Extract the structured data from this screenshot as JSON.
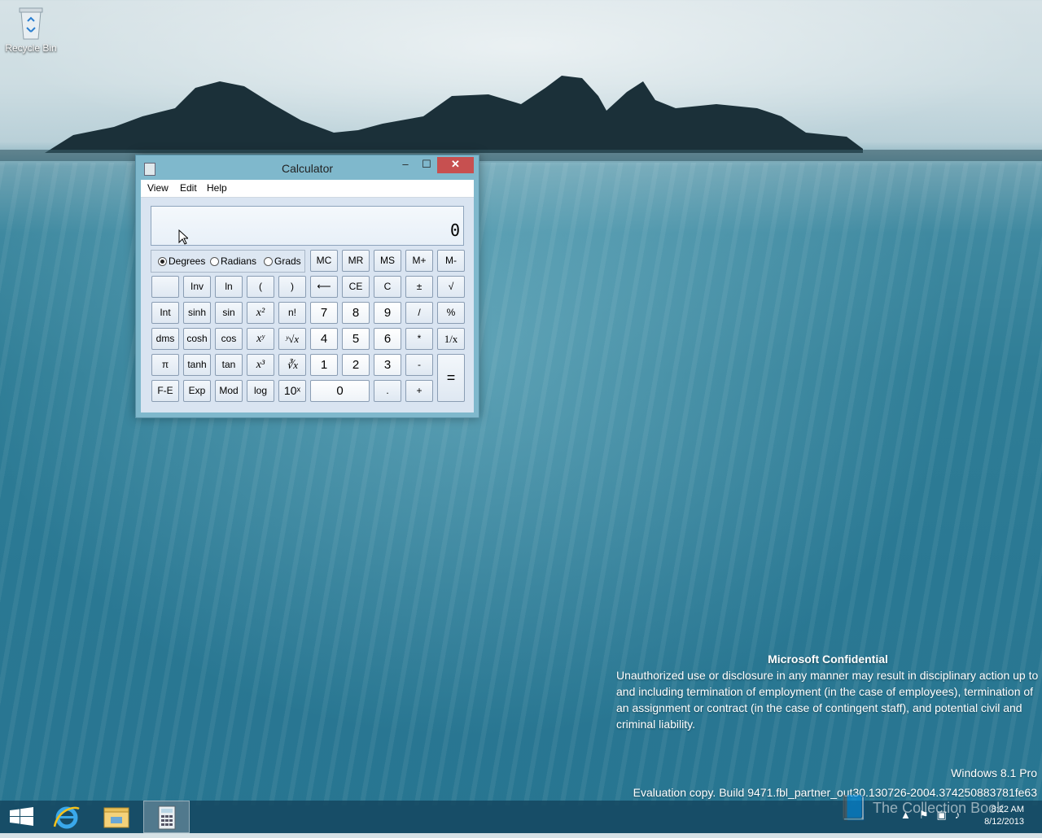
{
  "desktop": {
    "icons": [
      {
        "label": "Recycle Bin",
        "icon": "recycle-bin-icon"
      }
    ]
  },
  "calculator": {
    "title": "Calculator",
    "window_buttons": {
      "minimize": "–",
      "maximize": "☐",
      "close": "✕"
    },
    "menu": [
      "View",
      "Edit",
      "Help"
    ],
    "display_value": "0",
    "angle_modes": [
      {
        "label": "Degrees",
        "selected": true
      },
      {
        "label": "Radians",
        "selected": false
      },
      {
        "label": "Grads",
        "selected": false
      }
    ],
    "memory_keys": [
      "MC",
      "MR",
      "MS",
      "M+",
      "M-"
    ],
    "keys": {
      "r1": [
        "",
        "Inv",
        "ln",
        "(",
        ")",
        "⟵",
        "CE",
        "C",
        "±",
        "√"
      ],
      "r2": [
        "Int",
        "sinh",
        "sin",
        "x²",
        "n!",
        "7",
        "8",
        "9",
        "/",
        "%"
      ],
      "r3": [
        "dms",
        "cosh",
        "cos",
        "xʸ",
        "ʸ√x",
        "4",
        "5",
        "6",
        "*",
        "1/x"
      ],
      "r4": [
        "π",
        "tanh",
        "tan",
        "x³",
        "∛x",
        "1",
        "2",
        "3",
        "-",
        "="
      ],
      "r5": [
        "F-E",
        "Exp",
        "Mod",
        "log",
        "10ˣ",
        "0",
        ".",
        "+"
      ]
    }
  },
  "notice": {
    "title": "Microsoft Confidential",
    "body": "Unauthorized use or disclosure in any manner may result in disciplinary action up to and including termination of employment (in the case of employees), termination of an assignment or contract (in the case of contingent staff), and potential civil and criminal liability.",
    "edition": "Windows 8.1 Pro",
    "build": "Evaluation copy. Build 9471.fbl_partner_out30.130726-2004.374250883781fe63"
  },
  "taskbar": {
    "items": [
      {
        "name": "start",
        "icon": "windows-logo-icon"
      },
      {
        "name": "internet-explorer",
        "icon": "ie-icon"
      },
      {
        "name": "file-explorer",
        "icon": "folder-icon"
      },
      {
        "name": "calculator",
        "icon": "calculator-icon",
        "active": true
      }
    ],
    "clock_time": "8:22 AM",
    "clock_date": "8/12/2013",
    "watermark": "The Collection Book"
  }
}
